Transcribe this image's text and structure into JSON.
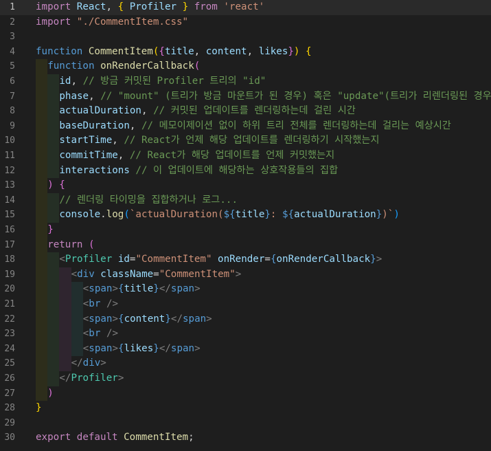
{
  "editor": {
    "lines": [
      {
        "n": "1",
        "current": true,
        "indent": 0,
        "tokens": [
          [
            "kw",
            "import"
          ],
          [
            "pl",
            " "
          ],
          [
            "var",
            "React"
          ],
          [
            "pl",
            ", "
          ],
          [
            "b1",
            "{"
          ],
          [
            "pl",
            " "
          ],
          [
            "var",
            "Profiler"
          ],
          [
            "pl",
            " "
          ],
          [
            "b1",
            "}"
          ],
          [
            "pl",
            " "
          ],
          [
            "kw",
            "from"
          ],
          [
            "pl",
            " "
          ],
          [
            "str",
            "'react'"
          ]
        ]
      },
      {
        "n": "2",
        "indent": 0,
        "tokens": [
          [
            "kw",
            "import"
          ],
          [
            "pl",
            " "
          ],
          [
            "str",
            "\"./CommentItem.css\""
          ]
        ]
      },
      {
        "n": "3",
        "indent": 0,
        "tokens": []
      },
      {
        "n": "4",
        "indent": 0,
        "tokens": [
          [
            "kw2",
            "function"
          ],
          [
            "pl",
            " "
          ],
          [
            "fn",
            "CommentItem"
          ],
          [
            "b1",
            "("
          ],
          [
            "b2",
            "{"
          ],
          [
            "var",
            "title"
          ],
          [
            "pl",
            ", "
          ],
          [
            "var",
            "content"
          ],
          [
            "pl",
            ", "
          ],
          [
            "var",
            "likes"
          ],
          [
            "b2",
            "}"
          ],
          [
            "b1",
            ")"
          ],
          [
            "pl",
            " "
          ],
          [
            "b1",
            "{"
          ]
        ]
      },
      {
        "n": "5",
        "indent": 1,
        "tokens": [
          [
            "kw2",
            "function"
          ],
          [
            "pl",
            " "
          ],
          [
            "fn",
            "onRenderCallback"
          ],
          [
            "b2",
            "("
          ]
        ]
      },
      {
        "n": "6",
        "indent": 2,
        "tokens": [
          [
            "var",
            "id"
          ],
          [
            "pl",
            ", "
          ],
          [
            "cmt",
            "// 방금 커밋된 Profiler 트리의 \"id\""
          ]
        ]
      },
      {
        "n": "7",
        "indent": 2,
        "tokens": [
          [
            "var",
            "phase"
          ],
          [
            "pl",
            ", "
          ],
          [
            "cmt",
            "// \"mount\" (트리가 방금 마운트가 된 경우) 혹은 \"update\"(트리가 리렌더링된 경우)"
          ]
        ]
      },
      {
        "n": "8",
        "indent": 2,
        "tokens": [
          [
            "var",
            "actualDuration"
          ],
          [
            "pl",
            ", "
          ],
          [
            "cmt",
            "// 커밋된 업데이트를 렌더링하는데 걸린 시간"
          ]
        ]
      },
      {
        "n": "9",
        "indent": 2,
        "tokens": [
          [
            "var",
            "baseDuration"
          ],
          [
            "pl",
            ", "
          ],
          [
            "cmt",
            "// 메모이제이션 없이 하위 트리 전체를 렌더링하는데 걸리는 예상시간"
          ]
        ]
      },
      {
        "n": "10",
        "indent": 2,
        "tokens": [
          [
            "var",
            "startTime"
          ],
          [
            "pl",
            ", "
          ],
          [
            "cmt",
            "// React가 언제 해당 업데이트를 렌더링하기 시작했는지"
          ]
        ]
      },
      {
        "n": "11",
        "indent": 2,
        "tokens": [
          [
            "var",
            "commitTime"
          ],
          [
            "pl",
            ", "
          ],
          [
            "cmt",
            "// React가 해당 업데이트를 언제 커밋했는지"
          ]
        ]
      },
      {
        "n": "12",
        "indent": 2,
        "tokens": [
          [
            "var",
            "interactions"
          ],
          [
            "pl",
            " "
          ],
          [
            "cmt",
            "// 이 업데이트에 해당하는 상호작용들의 집합"
          ]
        ]
      },
      {
        "n": "13",
        "indent": 1,
        "tokens": [
          [
            "b2",
            ")"
          ],
          [
            "pl",
            " "
          ],
          [
            "b2",
            "{"
          ]
        ]
      },
      {
        "n": "14",
        "indent": 2,
        "tokens": [
          [
            "cmt",
            "// 렌더링 타이밍을 집합하거나 로그..."
          ]
        ]
      },
      {
        "n": "15",
        "indent": 2,
        "tokens": [
          [
            "var",
            "console"
          ],
          [
            "pl",
            "."
          ],
          [
            "fn",
            "log"
          ],
          [
            "b3",
            "("
          ],
          [
            "str",
            "`actualDuration("
          ],
          [
            "kw2",
            "${"
          ],
          [
            "var",
            "title"
          ],
          [
            "kw2",
            "}"
          ],
          [
            "str",
            ": "
          ],
          [
            "kw2",
            "${"
          ],
          [
            "var",
            "actualDuration"
          ],
          [
            "kw2",
            "}"
          ],
          [
            "str",
            ")`"
          ],
          [
            "b3",
            ")"
          ]
        ]
      },
      {
        "n": "16",
        "indent": 1,
        "tokens": [
          [
            "b2",
            "}"
          ]
        ]
      },
      {
        "n": "17",
        "indent": 1,
        "tokens": [
          [
            "kw",
            "return"
          ],
          [
            "pl",
            " "
          ],
          [
            "b2",
            "("
          ]
        ]
      },
      {
        "n": "18",
        "indent": 2,
        "tokens": [
          [
            "punc",
            "<"
          ],
          [
            "cmp",
            "Profiler"
          ],
          [
            "pl",
            " "
          ],
          [
            "attr",
            "id"
          ],
          [
            "pl",
            "="
          ],
          [
            "str",
            "\"CommentItem\""
          ],
          [
            "pl",
            " "
          ],
          [
            "attr",
            "onRender"
          ],
          [
            "pl",
            "="
          ],
          [
            "kw2",
            "{"
          ],
          [
            "var",
            "onRenderCallback"
          ],
          [
            "kw2",
            "}"
          ],
          [
            "punc",
            ">"
          ]
        ]
      },
      {
        "n": "19",
        "indent": 3,
        "tokens": [
          [
            "punc",
            "<"
          ],
          [
            "tag",
            "div"
          ],
          [
            "pl",
            " "
          ],
          [
            "attr",
            "className"
          ],
          [
            "pl",
            "="
          ],
          [
            "str",
            "\"CommentItem\""
          ],
          [
            "punc",
            ">"
          ]
        ]
      },
      {
        "n": "20",
        "indent": 4,
        "tokens": [
          [
            "punc",
            "<"
          ],
          [
            "tag",
            "span"
          ],
          [
            "punc",
            ">"
          ],
          [
            "kw2",
            "{"
          ],
          [
            "var",
            "title"
          ],
          [
            "kw2",
            "}"
          ],
          [
            "punc",
            "</"
          ],
          [
            "tag",
            "span"
          ],
          [
            "punc",
            ">"
          ]
        ]
      },
      {
        "n": "21",
        "indent": 4,
        "tokens": [
          [
            "punc",
            "<"
          ],
          [
            "tag",
            "br"
          ],
          [
            "pl",
            " "
          ],
          [
            "punc",
            "/>"
          ]
        ]
      },
      {
        "n": "22",
        "indent": 4,
        "tokens": [
          [
            "punc",
            "<"
          ],
          [
            "tag",
            "span"
          ],
          [
            "punc",
            ">"
          ],
          [
            "kw2",
            "{"
          ],
          [
            "var",
            "content"
          ],
          [
            "kw2",
            "}"
          ],
          [
            "punc",
            "</"
          ],
          [
            "tag",
            "span"
          ],
          [
            "punc",
            ">"
          ]
        ]
      },
      {
        "n": "23",
        "indent": 4,
        "tokens": [
          [
            "punc",
            "<"
          ],
          [
            "tag",
            "br"
          ],
          [
            "pl",
            " "
          ],
          [
            "punc",
            "/>"
          ]
        ]
      },
      {
        "n": "24",
        "indent": 4,
        "tokens": [
          [
            "punc",
            "<"
          ],
          [
            "tag",
            "span"
          ],
          [
            "punc",
            ">"
          ],
          [
            "kw2",
            "{"
          ],
          [
            "var",
            "likes"
          ],
          [
            "kw2",
            "}"
          ],
          [
            "punc",
            "</"
          ],
          [
            "tag",
            "span"
          ],
          [
            "punc",
            ">"
          ]
        ]
      },
      {
        "n": "25",
        "indent": 3,
        "tokens": [
          [
            "punc",
            "</"
          ],
          [
            "tag",
            "div"
          ],
          [
            "punc",
            ">"
          ]
        ]
      },
      {
        "n": "26",
        "indent": 2,
        "tokens": [
          [
            "punc",
            "</"
          ],
          [
            "cmp",
            "Profiler"
          ],
          [
            "punc",
            ">"
          ]
        ]
      },
      {
        "n": "27",
        "indent": 1,
        "tokens": [
          [
            "b2",
            ")"
          ]
        ]
      },
      {
        "n": "28",
        "indent": 0,
        "tokens": [
          [
            "b1",
            "}"
          ]
        ]
      },
      {
        "n": "29",
        "indent": 0,
        "tokens": []
      },
      {
        "n": "30",
        "indent": 0,
        "tokens": [
          [
            "kw",
            "export"
          ],
          [
            "pl",
            " "
          ],
          [
            "kw",
            "default"
          ],
          [
            "pl",
            " "
          ],
          [
            "fn",
            "CommentItem"
          ],
          [
            "pl",
            ";"
          ]
        ]
      }
    ]
  },
  "colors": {
    "background": "#1e1e1e",
    "current_line": "#2a2a2a",
    "line_number": "#858585",
    "keyword": "#c586c0",
    "storage": "#569cd6",
    "function": "#dcdcaa",
    "variable": "#9cdcfe",
    "string": "#ce9178",
    "comment": "#6a9955",
    "component": "#4ec9b0",
    "bracket_1": "#ffd700",
    "bracket_2": "#da70d6",
    "bracket_3": "#179fff"
  }
}
